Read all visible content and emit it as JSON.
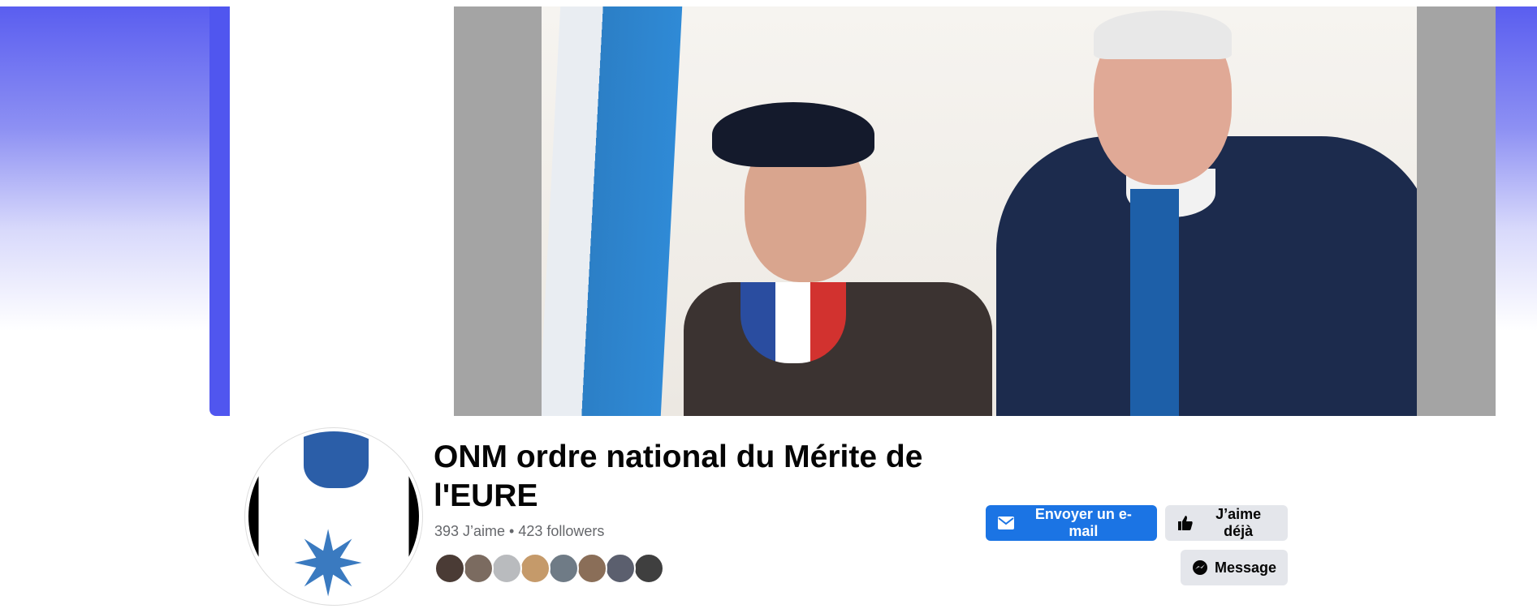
{
  "page": {
    "name": "ONM ordre national du Mérite de l'EURE",
    "stats": "393 J’aime • 423 followers"
  },
  "friends": [
    {
      "color": "#4a3b35"
    },
    {
      "color": "#7b6b60"
    },
    {
      "color": "#b9bbbe"
    },
    {
      "color": "#c59a6a"
    },
    {
      "color": "#6f7b86"
    },
    {
      "color": "#8a6e58"
    },
    {
      "color": "#5b5f6e"
    },
    {
      "color": "#3f3f3f"
    }
  ],
  "actions": {
    "email_label": "Envoyer un e-mail",
    "like_label": "J’aime déjà",
    "message_label": "Message"
  },
  "colors": {
    "accent": "#1b74e4",
    "cover_frame": "#5056ef"
  },
  "icons": [
    "mail-icon",
    "thumbs-up-icon",
    "messenger-icon"
  ]
}
